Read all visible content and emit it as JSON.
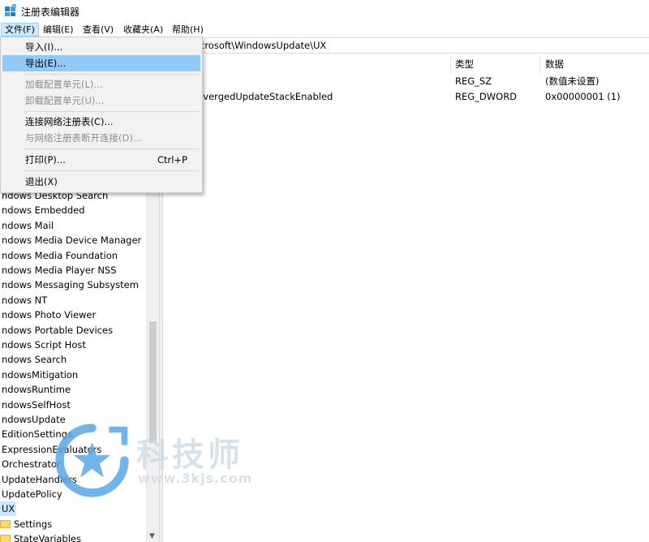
{
  "window": {
    "title": "注册表编辑器"
  },
  "menubar": {
    "items": [
      "文件(F)",
      "编辑(E)",
      "查看(V)",
      "收藏夹(A)",
      "帮助(H)"
    ],
    "active_index": 0
  },
  "address": {
    "path_visible": "crosoft\\WindowsUpdate\\UX"
  },
  "file_menu": {
    "items": [
      {
        "label": "导入(I)...",
        "enabled": true
      },
      {
        "label": "导出(E)...",
        "enabled": true,
        "hover": true
      },
      {
        "label": "加载配置单元(L)...",
        "enabled": false
      },
      {
        "label": "卸载配置单元(U)...",
        "enabled": false
      },
      {
        "label": "连接网络注册表(C)...",
        "enabled": true
      },
      {
        "label": "与网络注册表断开连接(D)...",
        "enabled": false
      },
      {
        "label": "打印(P)...",
        "enabled": true,
        "accelerator": "Ctrl+P"
      },
      {
        "label": "退出(X)",
        "enabled": true
      }
    ]
  },
  "tree": {
    "items": [
      {
        "label": "ndows Desktop Search",
        "folder": false
      },
      {
        "label": "ndows Embedded",
        "folder": false
      },
      {
        "label": "ndows Mail",
        "folder": false
      },
      {
        "label": "ndows Media Device Manager",
        "folder": false
      },
      {
        "label": "ndows Media Foundation",
        "folder": false
      },
      {
        "label": "ndows Media Player NSS",
        "folder": false
      },
      {
        "label": "ndows Messaging Subsystem",
        "folder": false
      },
      {
        "label": "ndows NT",
        "folder": false
      },
      {
        "label": "ndows Photo Viewer",
        "folder": false
      },
      {
        "label": "ndows Portable Devices",
        "folder": false
      },
      {
        "label": "ndows Script Host",
        "folder": false
      },
      {
        "label": "ndows Search",
        "folder": false
      },
      {
        "label": "ndowsMitigation",
        "folder": false
      },
      {
        "label": "ndowsRuntime",
        "folder": false
      },
      {
        "label": "ndowsSelfHost",
        "folder": false
      },
      {
        "label": "ndowsUpdate",
        "folder": false
      },
      {
        "label": "EditionSettings",
        "folder": false
      },
      {
        "label": "ExpressionEvaluators",
        "folder": false
      },
      {
        "label": "Orchestrator",
        "folder": false
      },
      {
        "label": "UpdateHandlers",
        "folder": false
      },
      {
        "label": "UpdatePolicy",
        "folder": false
      },
      {
        "label": "UX",
        "folder": false,
        "selected": true
      },
      {
        "label": "Settings",
        "folder": true
      },
      {
        "label": "StateVariables",
        "folder": true
      }
    ]
  },
  "list": {
    "headers": {
      "name": "",
      "type": "类型",
      "data": "数据"
    },
    "rows": [
      {
        "name": ")",
        "type": "REG_SZ",
        "data": "(数值未设置)"
      },
      {
        "name": "nvergedUpdateStackEnabled",
        "type": "REG_DWORD",
        "data": "0x00000001 (1)"
      }
    ]
  },
  "watermark": {
    "text": "科技师",
    "url": "www.3kjs.com"
  },
  "colors": {
    "selection": "#cce8ff",
    "menu_hover": "#91c9f7",
    "disabled_text": "#8d8d8d"
  }
}
